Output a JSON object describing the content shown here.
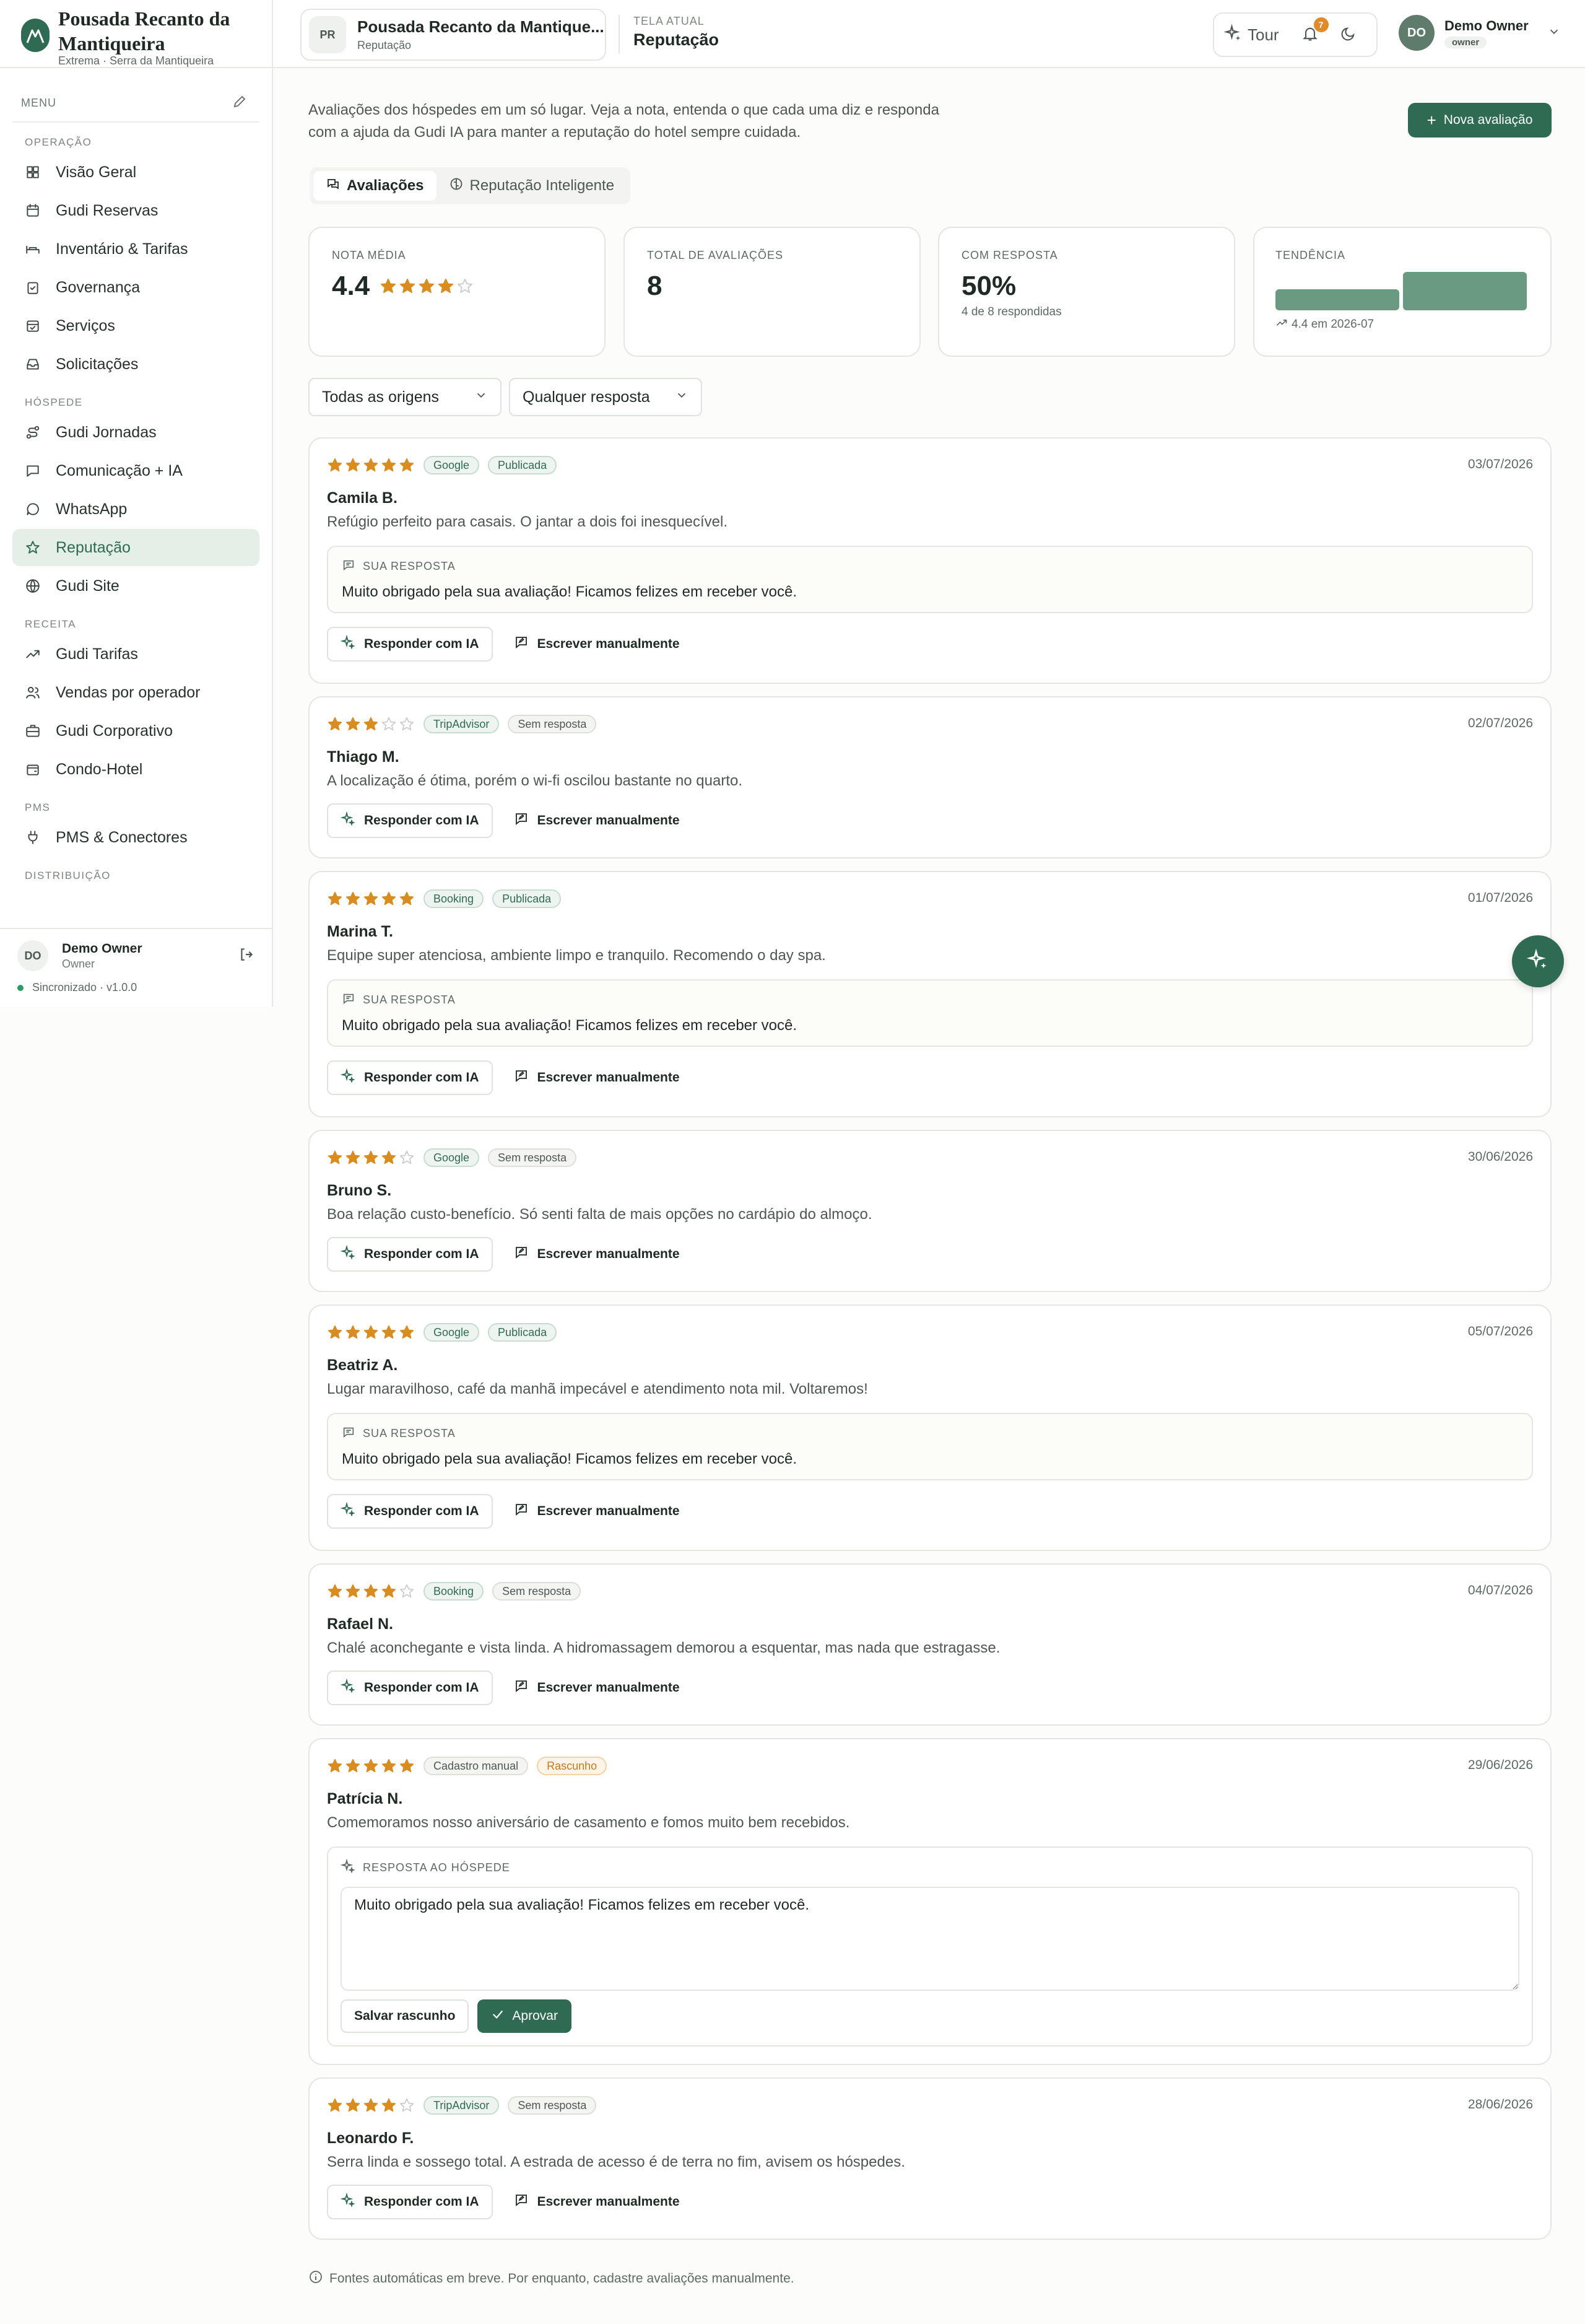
{
  "brand": {
    "name": "Pousada Recanto da Mantiqueira",
    "location": "Extrema · Serra da Mantiqueira"
  },
  "menu": {
    "title": "MENU"
  },
  "nav_sections": [
    {
      "label": "OPERAÇÃO",
      "items": [
        {
          "label": "Visão Geral",
          "icon": "grid-icon"
        },
        {
          "label": "Gudi Reservas",
          "icon": "calendar-icon"
        },
        {
          "label": "Inventário & Tarifas",
          "icon": "bed-icon"
        },
        {
          "label": "Governança",
          "icon": "clipboard-check-icon"
        },
        {
          "label": "Serviços",
          "icon": "calendar-check-icon"
        },
        {
          "label": "Solicitações",
          "icon": "inbox-icon"
        }
      ]
    },
    {
      "label": "HÓSPEDE",
      "items": [
        {
          "label": "Gudi Jornadas",
          "icon": "route-icon"
        },
        {
          "label": "Comunicação + IA",
          "icon": "message-square-icon"
        },
        {
          "label": "WhatsApp",
          "icon": "message-circle-icon"
        },
        {
          "label": "Reputação",
          "icon": "star-icon",
          "active": true
        },
        {
          "label": "Gudi Site",
          "icon": "globe-icon"
        }
      ]
    },
    {
      "label": "RECEITA",
      "items": [
        {
          "label": "Gudi Tarifas",
          "icon": "trending-up-icon"
        },
        {
          "label": "Vendas por operador",
          "icon": "users-icon"
        },
        {
          "label": "Gudi Corporativo",
          "icon": "briefcase-icon"
        },
        {
          "label": "Condo-Hotel",
          "icon": "wallet-icon"
        }
      ]
    },
    {
      "label": "PMS",
      "items": [
        {
          "label": "PMS & Conectores",
          "icon": "plug-icon"
        }
      ]
    },
    {
      "label": "DISTRIBUIÇÃO",
      "items": []
    }
  ],
  "sidebar_user": {
    "initials": "DO",
    "name": "Demo Owner",
    "role": "Owner",
    "sync": "Sincronizado · v1.0.0"
  },
  "topbar": {
    "property_initials": "PR",
    "property_name": "Pousada Recanto da Mantique...",
    "property_sub": "Reputação",
    "screen_label": "TELA ATUAL",
    "screen_name": "Reputação",
    "tour": "Tour",
    "notif_count": "7",
    "user_initials": "DO",
    "user_name": "Demo Owner",
    "user_role": "owner"
  },
  "page": {
    "intro": "Avaliações dos hóspedes em um só lugar. Veja a nota, entenda o que cada uma diz e responda com a ajuda da Gudi IA para manter a reputação do hotel sempre cuidada.",
    "new_button": "Nova avaliação",
    "tabs": [
      "Avaliações",
      "Reputação Inteligente"
    ],
    "footer_note": "Fontes automáticas em breve. Por enquanto, cadastre avaliações manualmente."
  },
  "stats": {
    "avg_label": "NOTA MÉDIA",
    "avg_value": "4.4",
    "avg_stars": 4,
    "total_label": "TOTAL DE AVALIAÇÕES",
    "total_value": "8",
    "resp_label": "COM RESPOSTA",
    "resp_value": "50%",
    "resp_sub": "4 de 8 respondidas",
    "trend_label": "TENDÊNCIA",
    "trend_sub": "4.4 em 2026-07"
  },
  "trend_bars": [
    0.55,
    1.0
  ],
  "filters": {
    "origin": "Todas as origens",
    "response": "Qualquer resposta"
  },
  "labels": {
    "ai_reply": "Responder com IA",
    "manual_reply": "Escrever manualmente",
    "your_response": "SUA RESPOSTA",
    "guest_response": "RESPOSTA AO HÓSPEDE",
    "save_draft": "Salvar rascunho",
    "approve": "Aprovar"
  },
  "colors": {
    "accent": "#2f6b52",
    "star": "#d98c1f",
    "star_empty": "#c9cdc8"
  },
  "reviews": [
    {
      "stars": 5,
      "source": "Google",
      "status": "Publicada",
      "date": "03/07/2026",
      "name": "Camila B.",
      "text": "Refúgio perfeito para casais. O jantar a dois foi inesquecível.",
      "response": "Muito obrigado pela sua avaliação! Ficamos felizes em receber você."
    },
    {
      "stars": 3,
      "source": "TripAdvisor",
      "status": "Sem resposta",
      "date": "02/07/2026",
      "name": "Thiago M.",
      "text": "A localização é ótima, porém o wi-fi oscilou bastante no quarto."
    },
    {
      "stars": 5,
      "source": "Booking",
      "status": "Publicada",
      "date": "01/07/2026",
      "name": "Marina T.",
      "text": "Equipe super atenciosa, ambiente limpo e tranquilo. Recomendo o day spa.",
      "response": "Muito obrigado pela sua avaliação! Ficamos felizes em receber você."
    },
    {
      "stars": 4,
      "source": "Google",
      "status": "Sem resposta",
      "date": "30/06/2026",
      "name": "Bruno S.",
      "text": "Boa relação custo-benefício. Só senti falta de mais opções no cardápio do almoço."
    },
    {
      "stars": 5,
      "source": "Google",
      "status": "Publicada",
      "date": "05/07/2026",
      "name": "Beatriz A.",
      "text": "Lugar maravilhoso, café da manhã impecável e atendimento nota mil. Voltaremos!",
      "response": "Muito obrigado pela sua avaliação! Ficamos felizes em receber você."
    },
    {
      "stars": 4,
      "source": "Booking",
      "status": "Sem resposta",
      "date": "04/07/2026",
      "name": "Rafael N.",
      "text": "Chalé aconchegante e vista linda. A hidromassagem demorou a esquentar, mas nada que estragasse."
    },
    {
      "stars": 5,
      "source": "Cadastro manual",
      "status": "Rascunho",
      "date": "29/06/2026",
      "name": "Patrícia N.",
      "text": "Comemoramos nosso aniversário de casamento e fomos muito bem recebidos.",
      "draft": "Muito obrigado pela sua avaliação! Ficamos felizes em receber você."
    },
    {
      "stars": 4,
      "source": "TripAdvisor",
      "status": "Sem resposta",
      "date": "28/06/2026",
      "name": "Leonardo F.",
      "text": "Serra linda e sossego total. A estrada de acesso é de terra no fim, avisem os hóspedes."
    }
  ]
}
